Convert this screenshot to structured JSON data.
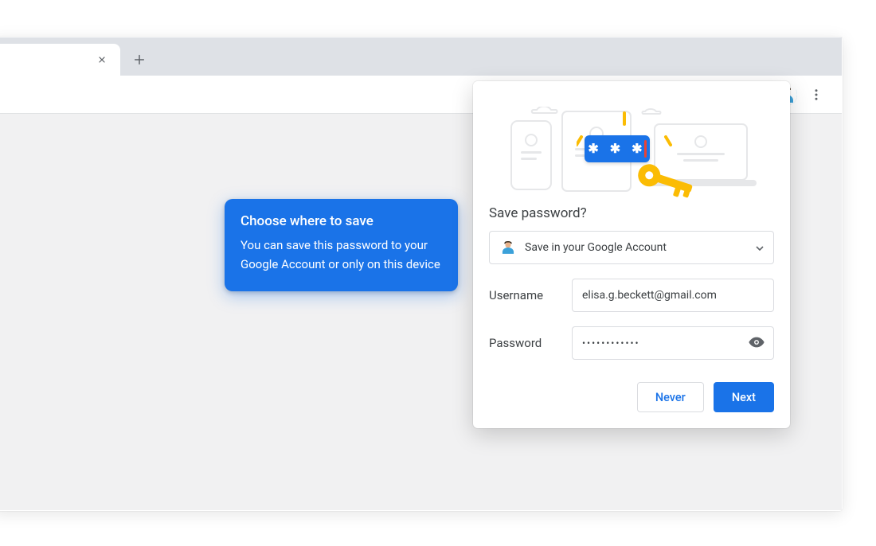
{
  "callout": {
    "title": "Choose where to save",
    "body": "You can save this password to your Google Account or only on this device"
  },
  "popup": {
    "title": "Save password?",
    "account_option": "Save in your Google Account",
    "username_label": "Username",
    "username_value": "elisa.g.beckett@gmail.com",
    "password_label": "Password",
    "password_masked": "••••••••••••",
    "never_label": "Never",
    "next_label": "Next"
  },
  "illustration": {
    "password_glyphs": "✱ ✱ ✱"
  },
  "colors": {
    "primary": "#1a73e8",
    "key_yellow": "#fbbc04"
  }
}
